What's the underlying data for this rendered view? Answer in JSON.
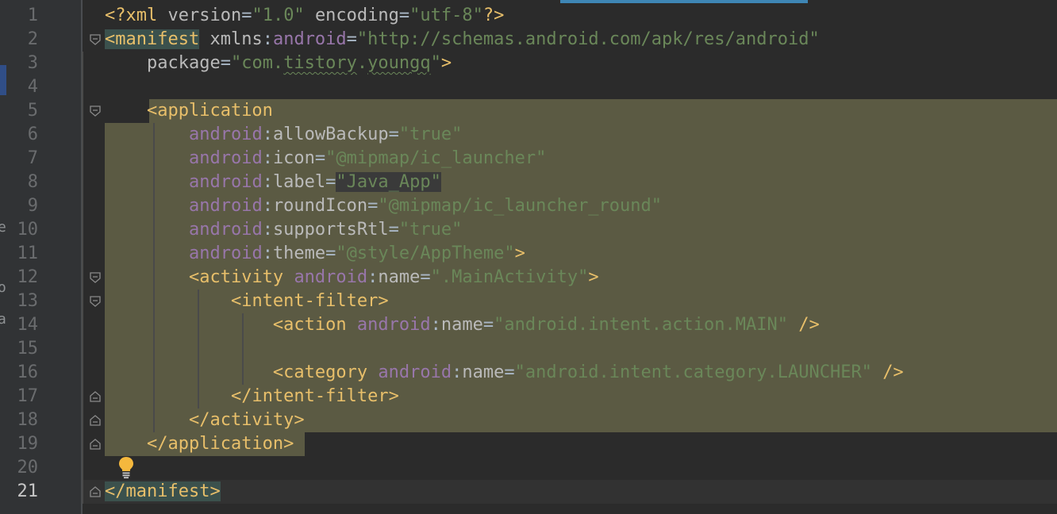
{
  "editor": {
    "current_line": 21,
    "lines": [
      {
        "n": "1",
        "tokens": [
          {
            "t": "pi",
            "v": "<?xml "
          },
          {
            "t": "attr",
            "v": "version"
          },
          {
            "t": "plain",
            "v": "="
          },
          {
            "t": "str",
            "v": "\"1.0\""
          },
          {
            "t": "plain",
            "v": " "
          },
          {
            "t": "attr",
            "v": "encoding"
          },
          {
            "t": "plain",
            "v": "="
          },
          {
            "t": "str",
            "v": "\"utf-8\""
          },
          {
            "t": "pi",
            "v": "?>"
          }
        ]
      },
      {
        "n": "2",
        "tokens": [
          {
            "t": "taghl",
            "v": "<manifest"
          },
          {
            "t": "plain",
            "v": " "
          },
          {
            "t": "attr",
            "v": "xmlns"
          },
          {
            "t": "plain",
            "v": ":"
          },
          {
            "t": "ns",
            "v": "android"
          },
          {
            "t": "plain",
            "v": "="
          },
          {
            "t": "str",
            "v": "\"http://schemas.android.com/apk/res/android\""
          }
        ]
      },
      {
        "n": "3",
        "tokens": [
          {
            "t": "plain",
            "v": "    "
          },
          {
            "t": "attr",
            "v": "package"
          },
          {
            "t": "plain",
            "v": "="
          },
          {
            "t": "str",
            "v": "\"com."
          },
          {
            "t": "strtypo",
            "v": "tistory"
          },
          {
            "t": "str",
            "v": "."
          },
          {
            "t": "strtypo",
            "v": "youngq"
          },
          {
            "t": "str",
            "v": "\""
          },
          {
            "t": "tag",
            "v": ">"
          }
        ]
      },
      {
        "n": "4",
        "tokens": []
      },
      {
        "n": "5",
        "tokens": [
          {
            "t": "plain",
            "v": "    "
          },
          {
            "t": "tag",
            "v": "<application"
          }
        ]
      },
      {
        "n": "6",
        "tokens": [
          {
            "t": "plain",
            "v": "        "
          },
          {
            "t": "ns",
            "v": "android"
          },
          {
            "t": "plain",
            "v": ":"
          },
          {
            "t": "attr",
            "v": "allowBackup"
          },
          {
            "t": "plain",
            "v": "="
          },
          {
            "t": "str",
            "v": "\"true\""
          }
        ]
      },
      {
        "n": "7",
        "tokens": [
          {
            "t": "plain",
            "v": "        "
          },
          {
            "t": "ns",
            "v": "android"
          },
          {
            "t": "plain",
            "v": ":"
          },
          {
            "t": "attr",
            "v": "icon"
          },
          {
            "t": "plain",
            "v": "="
          },
          {
            "t": "str",
            "v": "\"@mipmap/ic_launcher\""
          }
        ]
      },
      {
        "n": "8",
        "tokens": [
          {
            "t": "plain",
            "v": "        "
          },
          {
            "t": "ns",
            "v": "android"
          },
          {
            "t": "plain",
            "v": ":"
          },
          {
            "t": "attr",
            "v": "label"
          },
          {
            "t": "plain",
            "v": "="
          },
          {
            "t": "valhl",
            "v": "\"Java_App\""
          }
        ]
      },
      {
        "n": "9",
        "tokens": [
          {
            "t": "plain",
            "v": "        "
          },
          {
            "t": "ns",
            "v": "android"
          },
          {
            "t": "plain",
            "v": ":"
          },
          {
            "t": "attr",
            "v": "roundIcon"
          },
          {
            "t": "plain",
            "v": "="
          },
          {
            "t": "str",
            "v": "\"@mipmap/ic_launcher_round\""
          }
        ]
      },
      {
        "n": "10",
        "tokens": [
          {
            "t": "plain",
            "v": "        "
          },
          {
            "t": "ns",
            "v": "android"
          },
          {
            "t": "plain",
            "v": ":"
          },
          {
            "t": "attr",
            "v": "supportsRtl"
          },
          {
            "t": "plain",
            "v": "="
          },
          {
            "t": "str",
            "v": "\"true\""
          }
        ]
      },
      {
        "n": "11",
        "tokens": [
          {
            "t": "plain",
            "v": "        "
          },
          {
            "t": "ns",
            "v": "android"
          },
          {
            "t": "plain",
            "v": ":"
          },
          {
            "t": "attr",
            "v": "theme"
          },
          {
            "t": "plain",
            "v": "="
          },
          {
            "t": "str",
            "v": "\"@style/AppTheme\""
          },
          {
            "t": "tag",
            "v": ">"
          }
        ]
      },
      {
        "n": "12",
        "tokens": [
          {
            "t": "plain",
            "v": "        "
          },
          {
            "t": "tag",
            "v": "<activity"
          },
          {
            "t": "plain",
            "v": " "
          },
          {
            "t": "ns",
            "v": "android"
          },
          {
            "t": "plain",
            "v": ":"
          },
          {
            "t": "attr",
            "v": "name"
          },
          {
            "t": "plain",
            "v": "="
          },
          {
            "t": "str",
            "v": "\".MainActivity\""
          },
          {
            "t": "tag",
            "v": ">"
          }
        ]
      },
      {
        "n": "13",
        "tokens": [
          {
            "t": "plain",
            "v": "            "
          },
          {
            "t": "tag",
            "v": "<intent-filter>"
          }
        ]
      },
      {
        "n": "14",
        "tokens": [
          {
            "t": "plain",
            "v": "                "
          },
          {
            "t": "tag",
            "v": "<action"
          },
          {
            "t": "plain",
            "v": " "
          },
          {
            "t": "ns",
            "v": "android"
          },
          {
            "t": "plain",
            "v": ":"
          },
          {
            "t": "attr",
            "v": "name"
          },
          {
            "t": "plain",
            "v": "="
          },
          {
            "t": "str",
            "v": "\"android.intent.action.MAIN\""
          },
          {
            "t": "plain",
            "v": " "
          },
          {
            "t": "tag",
            "v": "/>"
          }
        ]
      },
      {
        "n": "15",
        "tokens": []
      },
      {
        "n": "16",
        "tokens": [
          {
            "t": "plain",
            "v": "                "
          },
          {
            "t": "tag",
            "v": "<category"
          },
          {
            "t": "plain",
            "v": " "
          },
          {
            "t": "ns",
            "v": "android"
          },
          {
            "t": "plain",
            "v": ":"
          },
          {
            "t": "attr",
            "v": "name"
          },
          {
            "t": "plain",
            "v": "="
          },
          {
            "t": "str",
            "v": "\"android.intent.category.LAUNCHER\""
          },
          {
            "t": "plain",
            "v": " "
          },
          {
            "t": "tag",
            "v": "/>"
          }
        ]
      },
      {
        "n": "17",
        "tokens": [
          {
            "t": "plain",
            "v": "            "
          },
          {
            "t": "tag",
            "v": "</intent-filter>"
          }
        ]
      },
      {
        "n": "18",
        "tokens": [
          {
            "t": "plain",
            "v": "        "
          },
          {
            "t": "tag",
            "v": "</activity>"
          }
        ]
      },
      {
        "n": "19",
        "tokens": [
          {
            "t": "plain",
            "v": "    "
          },
          {
            "t": "tag",
            "v": "</application>"
          }
        ]
      },
      {
        "n": "20",
        "tokens": []
      },
      {
        "n": "21",
        "tokens": [
          {
            "t": "taghl",
            "v": "</manifest>"
          }
        ]
      }
    ]
  },
  "left_panel_fragments": [
    "e",
    "o",
    "a"
  ],
  "colors": {
    "background": "#2b2b2b",
    "gutter": "#313335",
    "selection": "#5b5a43",
    "tag": "#e8bf6a",
    "namespace": "#9876aa",
    "attribute": "#bababa",
    "string": "#6a8759",
    "line_number": "#6a6c6e",
    "intention_bulb": "#f5b83d"
  },
  "icons": [
    "fold-marker-icon",
    "fold-end-icon",
    "lightbulb-icon"
  ]
}
